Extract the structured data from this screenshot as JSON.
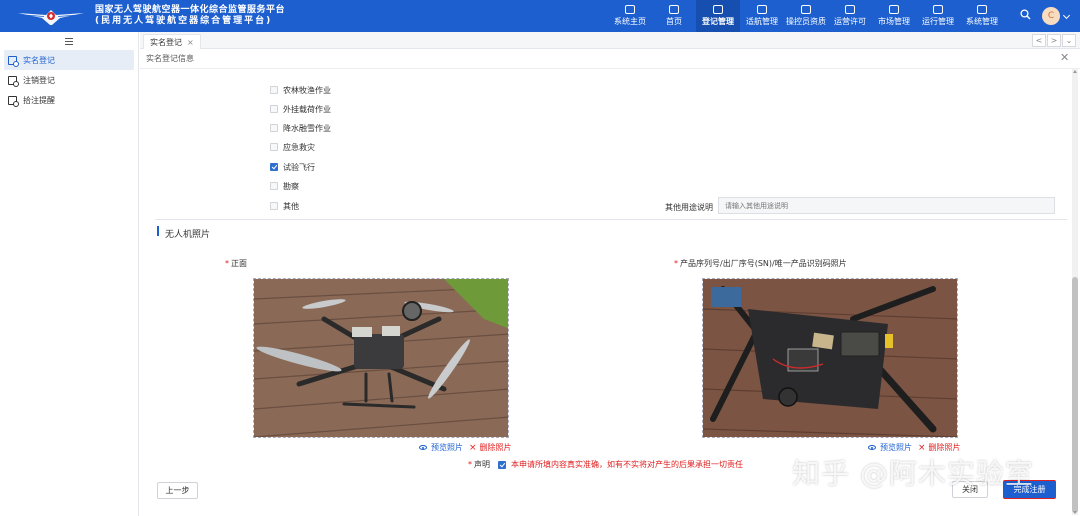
{
  "header": {
    "title_line1": "国家无人驾驶航空器一体化综合监管服务平台",
    "title_line2": "(民用无人驾驶航空器综合管理平台)",
    "nav": [
      {
        "label": "系统主页",
        "icon": "monitor-icon"
      },
      {
        "label": "首页",
        "icon": "home-icon"
      },
      {
        "label": "登记管理",
        "icon": "register-icon",
        "active": true
      },
      {
        "label": "适航管理",
        "icon": "drone-icon"
      },
      {
        "label": "操控员资质",
        "icon": "shield-icon"
      },
      {
        "label": "运营许可",
        "icon": "license-icon"
      },
      {
        "label": "市场管理",
        "icon": "market-icon"
      },
      {
        "label": "运行管理",
        "icon": "operation-icon"
      },
      {
        "label": "系统管理",
        "icon": "settings-icon"
      }
    ],
    "avatar_letter": "C",
    "accent": "#1d5fcf"
  },
  "sidebar": {
    "items": [
      {
        "label": "实名登记",
        "active": true
      },
      {
        "label": "注销登记"
      },
      {
        "label": "拾注提醒"
      }
    ]
  },
  "tabs": {
    "active_tab": "实名登记",
    "close_glyph": "×",
    "prev": "<",
    "next": ">",
    "more": "⌄"
  },
  "content": {
    "title": "实名登记信息",
    "close_glyph": "✕",
    "usage_options": [
      {
        "label": "农林牧渔作业",
        "checked": false
      },
      {
        "label": "外挂载荷作业",
        "checked": false
      },
      {
        "label": "降水融雪作业",
        "checked": false
      },
      {
        "label": "应急救灾",
        "checked": false
      },
      {
        "label": "试验飞行",
        "checked": true
      },
      {
        "label": "勘察",
        "checked": false
      },
      {
        "label": "其他",
        "checked": false
      }
    ],
    "other_usage": {
      "label": "其他用途说明",
      "placeholder": "请输入其他用途说明"
    },
    "photo_section": {
      "title": "无人机照片",
      "required_mark": "*",
      "front": {
        "label": "正面"
      },
      "serial": {
        "label": "产品序列号/出厂序号(SN)/唯一产品识别码照片"
      },
      "preview_label": "预览照片",
      "delete_label": "删除照片",
      "delete_glyph": "×"
    },
    "declaration": {
      "label": "声明",
      "checked": true,
      "text": "本申请所填内容真实准确，如有不实将对产生的后果承担一切责任"
    },
    "buttons": {
      "prev": "上一步",
      "close": "关闭",
      "done": "完成注册"
    },
    "watermark": "知乎 @阿木实验室"
  }
}
